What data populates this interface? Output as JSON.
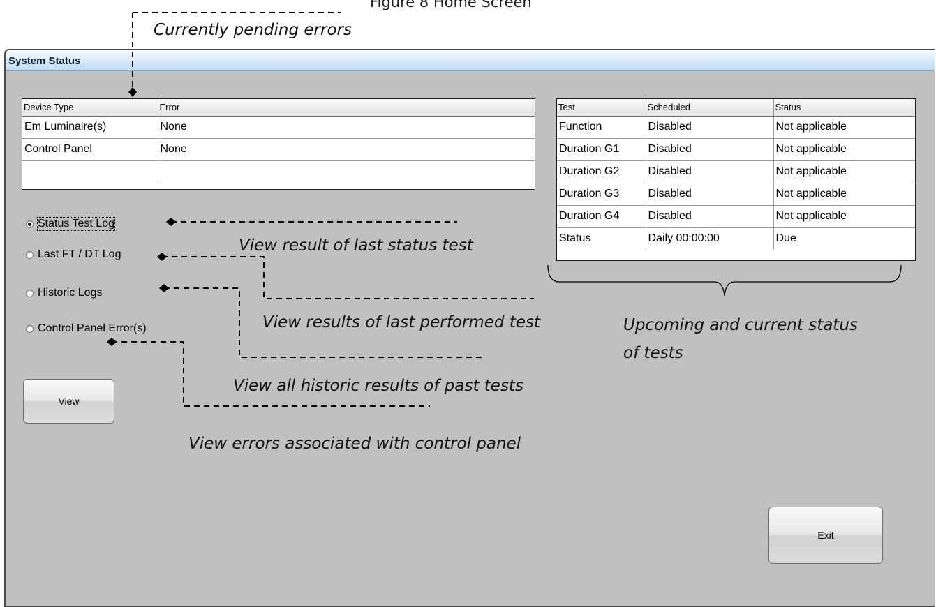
{
  "figure_caption": "Figure 8 Home Screen",
  "window": {
    "title": "System Status"
  },
  "errors_table": {
    "headers": [
      "Device Type",
      "Error"
    ],
    "rows": [
      [
        "Em Luminaire(s)",
        "None"
      ],
      [
        "Control Panel",
        "None"
      ],
      [
        "",
        ""
      ]
    ]
  },
  "tests_table": {
    "headers": [
      "Test",
      "Scheduled",
      "Status"
    ],
    "rows": [
      [
        "Function",
        "Disabled",
        "Not applicable"
      ],
      [
        "Duration G1",
        "Disabled",
        "Not applicable"
      ],
      [
        "Duration G2",
        "Disabled",
        "Not applicable"
      ],
      [
        "Duration G3",
        "Disabled",
        "Not applicable"
      ],
      [
        "Duration G4",
        "Disabled",
        "Not applicable"
      ],
      [
        "Status",
        "Daily 00:00:00",
        "Due"
      ]
    ]
  },
  "log_options": {
    "selected": "Status Test Log",
    "items": [
      "Status Test Log",
      "Last FT / DT Log",
      "Historic Logs",
      "Control Panel Error(s)"
    ]
  },
  "buttons": {
    "view": "View",
    "exit": "Exit"
  },
  "annotations": {
    "pending_errors": "Currently pending errors",
    "status_test": "View result of last status test",
    "last_test": "View results of last performed test",
    "historic": "View all historic results of past tests",
    "control_panel": "View errors associated with control panel",
    "upcoming": "Upcoming and current status",
    "upcoming_line2": "of tests"
  }
}
